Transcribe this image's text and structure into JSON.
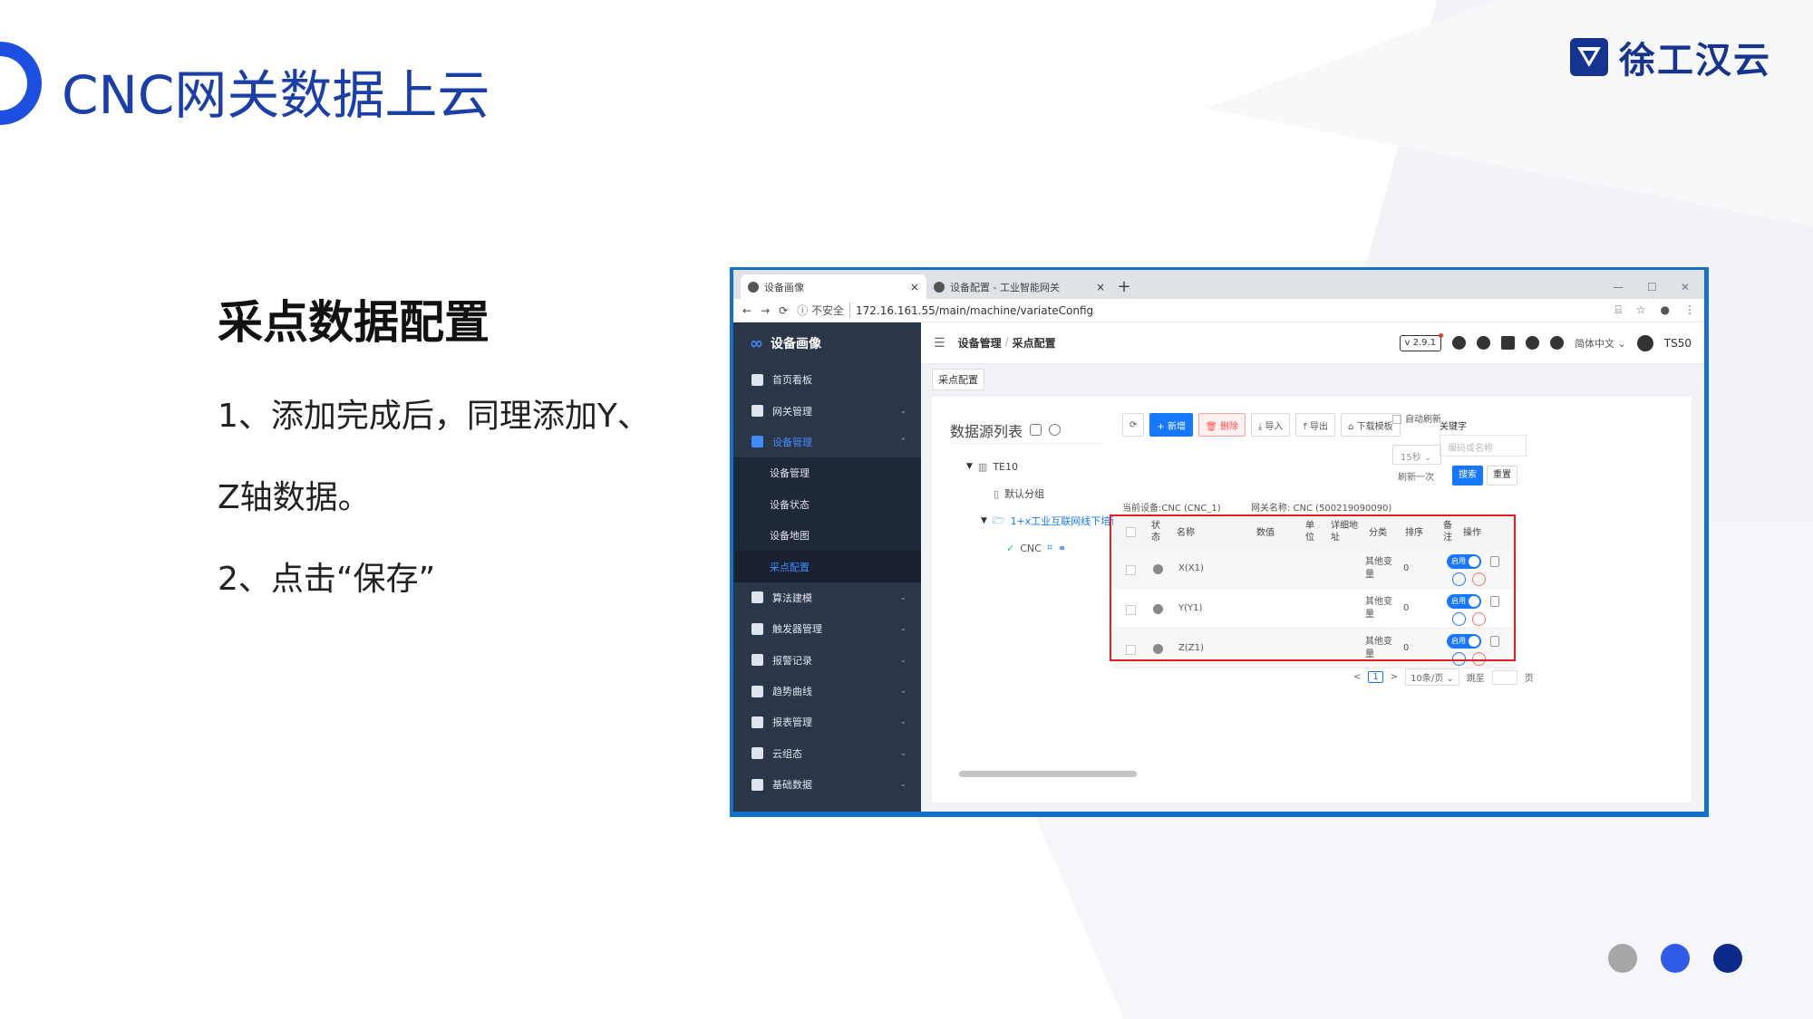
{
  "slide": {
    "title": "CNC网关数据上云",
    "logo_text": "徐工汉云",
    "section_heading": "采点数据配置",
    "step1_line1": "1、添加完成后，同理添加Y、",
    "step1_line2": "Z轴数据。",
    "step2": "2、点击“保存”",
    "colors": {
      "title": "#1b3fa8",
      "accent": "#1d4fe0",
      "dot_gray": "#a6a6a6",
      "dot_blue": "#2f5be6",
      "dot_navy": "#0c2a8a"
    }
  },
  "browser": {
    "tabs": [
      {
        "label": "设备画像",
        "close": "×"
      },
      {
        "label": "设备配置 - 工业智能网关",
        "close": "×"
      }
    ],
    "new_tab": "+",
    "window_controls": [
      "—",
      "☐",
      "✕"
    ],
    "nav": {
      "back": "←",
      "forward": "→",
      "reload": "⟳"
    },
    "address_insecure": "ⓘ 不安全",
    "address_url": "172.16.161.55/main/machine/variateConfig"
  },
  "app": {
    "brand": "设备画像",
    "sidebar": [
      {
        "label": "首页看板"
      },
      {
        "label": "网关管理",
        "chevron": "⌄"
      },
      {
        "label": "设备管理",
        "chevron": "⌃"
      }
    ],
    "sidebar_sub": [
      "设备管理",
      "设备状态",
      "设备地图",
      "采点配置"
    ],
    "sidebar_rest": [
      {
        "label": "算法建模",
        "chevron": "⌄"
      },
      {
        "label": "触发器管理",
        "chevron": "⌄"
      },
      {
        "label": "报警记录",
        "chevron": "⌄"
      },
      {
        "label": "趋势曲线",
        "chevron": "⌄"
      },
      {
        "label": "报表管理",
        "chevron": "⌄"
      },
      {
        "label": "云组态",
        "chevron": "⌄"
      },
      {
        "label": "基础数据",
        "chevron": "⌄"
      }
    ],
    "menu_toggle": "☰",
    "breadcrumb": [
      "设备管理",
      "/",
      "采点配置"
    ],
    "version": "v 2.9.1",
    "language": "简体中文 ⌄",
    "user": "TS50",
    "page_tag": "采点配置",
    "tree": {
      "title": "数据源列表",
      "root": "TE10",
      "default_group": "默认分组",
      "group": "1+x工业互联网线下培训",
      "device": "CNC"
    },
    "toolbar": {
      "refresh": "⟳",
      "add": "+ 新增",
      "delete": "🗑 删除",
      "import": "⤓ 导入",
      "export": "⤒ 导出",
      "download_template": "⌂ 下载模板"
    },
    "auto_refresh_label": "自动刷新",
    "refresh_interval": "15秒 ⌄",
    "refresh_once": "刷新一次",
    "keyword_label": "关键字",
    "keyword_placeholder": "编码或名称",
    "search": "搜索",
    "reset": "重置",
    "current_device": "当前设备:CNC (CNC_1)",
    "gateway_name": "网关名称: CNC (500219090090)",
    "table": {
      "headers": {
        "status": "状\n态",
        "name": "名称",
        "value": "数值",
        "unit": "单\n位",
        "detail": "详细地\n址",
        "category": "分类",
        "order": "排序",
        "remark": "备\n注",
        "action": "操作"
      },
      "rows": [
        {
          "name": "X(X1)",
          "category": "其他变量",
          "order": "0",
          "toggle": "启用"
        },
        {
          "name": "Y(Y1)",
          "category": "其他变量",
          "order": "0",
          "toggle": "启用"
        },
        {
          "name": "Z(Z1)",
          "category": "其他变量",
          "order": "0",
          "toggle": "启用"
        }
      ]
    },
    "pager": {
      "prev": "<",
      "current": "1",
      "next": ">",
      "page_size": "10条/页 ⌄",
      "jump_label": "跳至",
      "page_suffix": "页"
    }
  }
}
